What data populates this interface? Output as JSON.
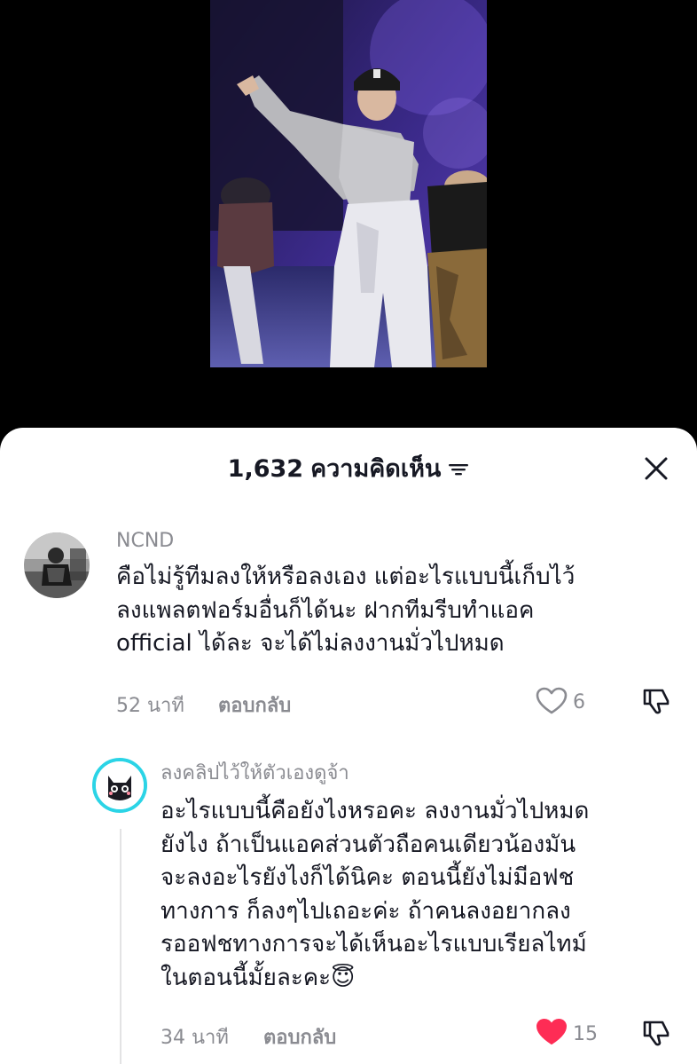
{
  "header": {
    "comment_count": "1,632",
    "comment_label": "ความคิดเห็น"
  },
  "comments": [
    {
      "username": "NCND",
      "lines": [
        "คือไม่รู้ทีมลงให้หรือลงเอง แต่อะไรแบบนี้เก็บไว้",
        "ลงแพลตฟอร์มอื่นก็ได้นะ ฝากทีมรีบทำแอค",
        "official ได้ละ จะได้ไม่ลงงานมั่วไปหมด"
      ],
      "time": "52 นาที",
      "reply_label": "ตอบกลับ",
      "likes": "6",
      "liked": false
    },
    {
      "username": "ลงคลิปไว้ให้ตัวเองดูจ้า",
      "lines": [
        "อะไรแบบนี้คือยังไงหรอคะ ลงงานมั่วไปหมด",
        "ยังไง ถ้าเป็นแอคส่วนตัวถือคนเดียวน้องมัน",
        "จะลงอะไรยังไงก็ได้นิคะ ตอนนี้ยังไม่มีอฟช",
        "ทางการ ก็ลงๆไปเถอะค่ะ ถ้าคนลงอยากลง",
        "รออฟชทางการจะได้เห็นอะไรแบบเรียลไทม์",
        "ในตอนนี้มั้ยละคะ😇"
      ],
      "time": "34 นาที",
      "reply_label": "ตอบกลับ",
      "likes": "15",
      "liked": true
    }
  ],
  "icons": {
    "filter": "filter-icon",
    "close": "close-icon",
    "like": "heart-icon",
    "dislike": "thumbs-down-icon"
  },
  "colors": {
    "text_primary": "#161823",
    "text_secondary": "#8a8b91",
    "like_active": "#fe2c55",
    "avatar_ring": "#2bd4e6"
  }
}
